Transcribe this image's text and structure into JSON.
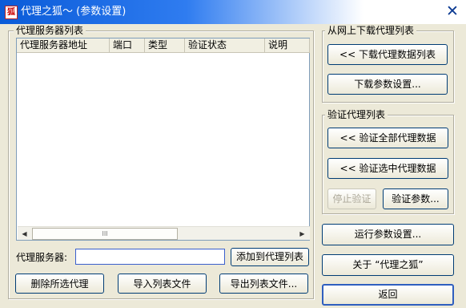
{
  "window": {
    "title": "代理之狐～ (参数设置)",
    "icon": "fox-app-icon",
    "close_glyph": "✕"
  },
  "proxy_list": {
    "group_label": "代理服务器列表",
    "columns": [
      "代理服务器地址",
      "端口",
      "类型",
      "验证状态",
      "说明"
    ],
    "rows": [],
    "scroll_left": "◀",
    "scroll_right": "▶",
    "scroll_grip": "III"
  },
  "proxy_input": {
    "label": "代理服务器:",
    "value": "",
    "add_button": "添加到代理列表"
  },
  "bottom_buttons": {
    "delete_selected": "删除所选代理",
    "import_list": "导入列表文件",
    "export_list": "导出列表文件..."
  },
  "download_group": {
    "label": "从网上下载代理列表",
    "download_button": "<< 下载代理数据列表",
    "settings_button": "下载参数设置..."
  },
  "verify_group": {
    "label": "验证代理列表",
    "verify_all": "<< 验证全部代理数据",
    "verify_selected": "<< 验证选中代理数据",
    "stop_verify": "停止验证",
    "verify_params": "验证参数..."
  },
  "side_buttons": {
    "run_settings": "运行参数设置...",
    "about": "关于 “代理之狐”",
    "back": "返回"
  },
  "colors": {
    "title_start": "#0a5bd8",
    "window_bg": "#ece9d8",
    "button_border": "#003c74"
  }
}
